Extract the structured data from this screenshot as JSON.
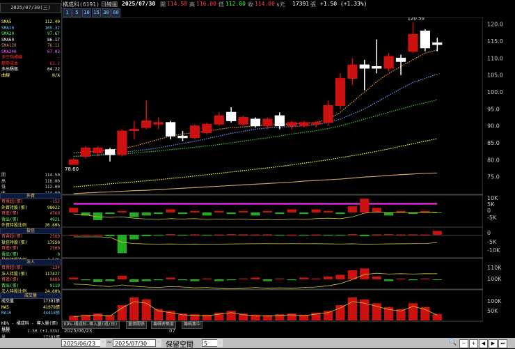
{
  "header": {
    "stock": "橘成科(6191)",
    "period": "日線圖",
    "date": "2025/07/30",
    "open_label": "開",
    "open": "114.50",
    "high_label": "高",
    "high": "116.00",
    "low_label": "低",
    "low": "112.00",
    "close_label": "收",
    "close": "114.00",
    "s_mark": "s元",
    "volume": "17391",
    "vol_unit": "張",
    "change": "+1.50 (+1.33%)"
  },
  "period_buttons": [
    "1",
    "5",
    "10",
    "15",
    "30",
    "60"
  ],
  "left": {
    "date": "2025/07/30(三)",
    "ma": [
      {
        "k": "SMA5",
        "v": "112.40",
        "c": "#ffff66"
      },
      {
        "k": "SMA10",
        "v": "105.32",
        "c": "#66ccff"
      },
      {
        "k": "SMA20",
        "v": "97.67",
        "c": "#66ff66"
      },
      {
        "k": "SMA60",
        "v": "86.17",
        "c": "#ffffff"
      },
      {
        "k": "SMA120",
        "v": "76.11",
        "c": "#cc9966"
      },
      {
        "k": "SMA240",
        "v": "67.03",
        "c": "#ff66ff"
      },
      {
        "k": "多空指標線",
        "v": "—",
        "c": "#ff3333"
      },
      {
        "k": "趨勢成本",
        "v": "63.2",
        "c": "#ff3333"
      },
      {
        "k": "多出積極",
        "v": "64.22",
        "c": "#ffffff"
      },
      {
        "k": "曲線",
        "v": "N/A",
        "c": "#ffff66"
      }
    ],
    "ohlc": [
      {
        "k": "開",
        "v": "114.50"
      },
      {
        "k": "高",
        "v": "116.00"
      },
      {
        "k": "低",
        "v": "112.00"
      },
      {
        "k": "收",
        "v": "114.00"
      }
    ],
    "foreign_head": "外資",
    "foreign": [
      {
        "k": "買賣超(張)",
        "v": "-152",
        "c": "#ff6666"
      },
      {
        "k": "外資持股(張)",
        "v": "98022",
        "c": "#ffff66"
      },
      {
        "k": "買進(張)",
        "v": "4769",
        "c": "#ff6666"
      },
      {
        "k": "賣出(張)",
        "v": "4921",
        "c": "#66ff66"
      },
      {
        "k": "外資持股比例",
        "v": "20.60%",
        "c": "#ffff66"
      }
    ],
    "dealer_head": "投信",
    "dealer": [
      {
        "k": "買賣超(張)",
        "v": "2569",
        "c": "#ff6666"
      },
      {
        "k": "投信持股(張)",
        "v": "17550",
        "c": "#ffff66"
      },
      {
        "k": "買進(張)",
        "v": "2569",
        "c": "#ff6666"
      },
      {
        "k": "賣出(張)",
        "v": "0",
        "c": "#66ff66"
      },
      {
        "k": "投信持股比例",
        "v": "3.52%",
        "c": "#ffff66"
      }
    ],
    "inst_head": "法人",
    "inst": [
      {
        "k": "買賣超(張)",
        "v": "-234",
        "c": "#ff6666"
      },
      {
        "k": "法人持股(張)",
        "v": "117427",
        "c": "#ffff66"
      },
      {
        "k": "買進(張)",
        "v": "8886",
        "c": "#ff6666"
      },
      {
        "k": "賣出(張)",
        "v": "9119",
        "c": "#66ff66"
      },
      {
        "k": "法人持股比例",
        "v": "24.60%",
        "c": "#ffff66"
      }
    ],
    "vol_head": "成交量",
    "vol": [
      {
        "k": "成交量",
        "v": "17391張",
        "c": "#ffffff"
      },
      {
        "k": "MA5",
        "v": "41078張",
        "c": "#ffff66"
      },
      {
        "k": "MA10",
        "v": "44418張",
        "c": "#66ccff"
      }
    ],
    "kd_label": "KD% - 橘成科 - 導入量(張) 日線",
    "bottom_rows": [
      {
        "k": "漲跌",
        "v": "1.50 (+1.33%)"
      },
      {
        "k": "量",
        "v": "17391張"
      }
    ]
  },
  "tabs": [
    "KD%-橘成科-導入量(週/日)",
    "量價關係",
    "籌碼密集度",
    "籌碼集中"
  ],
  "bottom": {
    "start_date": "2025/06/23",
    "sep": "~",
    "end_date": "2025/07/30",
    "reserve_label": "保留空間",
    "reserve_value": "5",
    "date_axis": [
      "2025/06/23",
      "07"
    ]
  },
  "axis": {
    "price_ticks": [
      "120.0",
      "115.0",
      "110.0",
      "105.0",
      "100.0",
      "95.0",
      "90.0",
      "85.0",
      "80.0",
      "75.0"
    ],
    "foreign_ticks": [
      "10K",
      "5K",
      "0",
      "-5K"
    ],
    "dealer_ticks": [
      "0",
      "-5K",
      "-10K"
    ],
    "inst_ticks": [
      "110K",
      "100K"
    ],
    "vol_ticks": [
      "100K",
      "50K"
    ]
  },
  "annotations": {
    "high": "120.50",
    "low": "78.60"
  },
  "colors": {
    "up": "#cc1111",
    "down": "#ffffff",
    "ma5": "#ff9933",
    "ma10": "#6699ff",
    "ma20": "#33cc33",
    "ma60": "#ffff33",
    "ma120": "#cc9966",
    "ma240": "#ff33ff",
    "panel_border": "#444444"
  },
  "chart_data": {
    "type": "candlestick",
    "candles": [
      {
        "o": 78.6,
        "h": 80.5,
        "l": 78.6,
        "c": 80.0
      },
      {
        "o": 81.0,
        "h": 84.0,
        "l": 80.5,
        "c": 83.5
      },
      {
        "o": 82.0,
        "h": 84.0,
        "l": 81.0,
        "c": 83.5
      },
      {
        "o": 83.0,
        "h": 83.5,
        "l": 79.5,
        "c": 81.5
      },
      {
        "o": 81.5,
        "h": 89.0,
        "l": 81.0,
        "c": 88.5
      },
      {
        "o": 89.0,
        "h": 91.5,
        "l": 86.0,
        "c": 89.0
      },
      {
        "o": 89.5,
        "h": 97.5,
        "l": 89.0,
        "c": 91.5
      },
      {
        "o": 90.5,
        "h": 92.5,
        "l": 89.0,
        "c": 91.0
      },
      {
        "o": 91.0,
        "h": 91.5,
        "l": 86.0,
        "c": 87.0
      },
      {
        "o": 87.0,
        "h": 88.5,
        "l": 85.5,
        "c": 86.5
      },
      {
        "o": 86.5,
        "h": 90.5,
        "l": 86.0,
        "c": 90.0
      },
      {
        "o": 88.0,
        "h": 91.0,
        "l": 87.5,
        "c": 90.5
      },
      {
        "o": 90.5,
        "h": 94.0,
        "l": 90.0,
        "c": 93.0
      },
      {
        "o": 94.0,
        "h": 95.5,
        "l": 91.0,
        "c": 91.5
      },
      {
        "o": 90.5,
        "h": 93.0,
        "l": 90.0,
        "c": 92.5
      },
      {
        "o": 92.0,
        "h": 92.5,
        "l": 89.5,
        "c": 90.0
      },
      {
        "o": 90.0,
        "h": 92.5,
        "l": 89.0,
        "c": 92.0
      },
      {
        "o": 93.0,
        "h": 94.0,
        "l": 89.0,
        "c": 90.0
      },
      {
        "o": 90.0,
        "h": 91.5,
        "l": 89.0,
        "c": 91.0
      },
      {
        "o": 90.0,
        "h": 91.5,
        "l": 89.5,
        "c": 91.0
      },
      {
        "o": 90.5,
        "h": 91.5,
        "l": 89.5,
        "c": 91.0
      },
      {
        "o": 91.0,
        "h": 97.5,
        "l": 90.0,
        "c": 96.0
      },
      {
        "o": 96.0,
        "h": 105.5,
        "l": 95.0,
        "c": 104.0
      },
      {
        "o": 104.0,
        "h": 110.0,
        "l": 102.0,
        "c": 108.0
      },
      {
        "o": 108.0,
        "h": 109.5,
        "l": 100.5,
        "c": 107.0
      },
      {
        "o": 107.5,
        "h": 115.5,
        "l": 105.5,
        "c": 107.0
      },
      {
        "o": 107.0,
        "h": 111.5,
        "l": 106.0,
        "c": 110.5
      },
      {
        "o": 110.0,
        "h": 111.0,
        "l": 105.0,
        "c": 109.0
      },
      {
        "o": 112.0,
        "h": 120.5,
        "l": 111.5,
        "c": 117.0
      },
      {
        "o": 118.0,
        "h": 118.5,
        "l": 112.0,
        "c": 113.0
      },
      {
        "o": 114.5,
        "h": 116.0,
        "l": 112.0,
        "c": 114.0
      }
    ],
    "ma_lines": {
      "ma5": [
        82,
        82.3,
        82.6,
        82.9,
        83.3,
        84,
        85,
        86,
        87,
        87.6,
        88,
        88.4,
        89,
        89.5,
        89.7,
        90,
        90.3,
        90.4,
        90.6,
        90.8,
        91,
        92,
        94,
        97,
        100,
        103,
        105.5,
        107.5,
        109.5,
        111.5,
        112.4
      ],
      "ma10": [
        81,
        81.2,
        81.5,
        81.8,
        82.2,
        82.6,
        83,
        83.5,
        84.2,
        84.8,
        85.5,
        86.2,
        87,
        87.8,
        88.4,
        89,
        89.4,
        89.6,
        89.8,
        90,
        90.3,
        91,
        92,
        93.5,
        95,
        97,
        99,
        101,
        102.8,
        104,
        105.3
      ],
      "ma20": [
        81,
        81.2,
        81.3,
        81.5,
        81.7,
        82,
        82.3,
        82.6,
        83,
        83.3,
        83.7,
        84.1,
        84.5,
        85,
        85.5,
        86,
        86.5,
        87,
        87.6,
        88.1,
        88.6,
        89.2,
        90,
        91,
        92,
        93,
        94,
        95,
        96,
        96.8,
        97.7
      ],
      "ma60": [
        72,
        72.3,
        72.6,
        72.9,
        73.2,
        73.5,
        73.8,
        74.1,
        74.5,
        74.8,
        75.2,
        75.6,
        76,
        76.4,
        76.8,
        77.2,
        77.6,
        78,
        78.5,
        79,
        79.5,
        80,
        80.6,
        81.2,
        81.8,
        82.5,
        83.2,
        84,
        84.7,
        85.5,
        86.2
      ],
      "ma120": [
        70,
        70.2,
        70.4,
        70.5,
        70.7,
        70.9,
        71,
        71.2,
        71.4,
        71.6,
        71.8,
        72,
        72.2,
        72.4,
        72.6,
        72.8,
        73,
        73.2,
        73.4,
        73.7,
        73.9,
        74.1,
        74.3,
        74.6,
        74.9,
        75.1,
        75.4,
        75.6,
        75.8,
        76,
        76.1
      ],
      "ma240": [
        67,
        67,
        67,
        67,
        67,
        67,
        67,
        67,
        67,
        67,
        67,
        67,
        67,
        67,
        67,
        67,
        67,
        67,
        67,
        67,
        67,
        67,
        67,
        67,
        67,
        67,
        67,
        67,
        67,
        67,
        67.03
      ]
    },
    "foreign_net": [
      3,
      -2,
      -5,
      -1,
      1,
      -3,
      -2,
      -1,
      2,
      -1,
      1,
      -2,
      1,
      -1,
      1,
      -2,
      1,
      -1,
      2,
      -1,
      2,
      1,
      -1,
      4,
      9,
      3,
      -2,
      1,
      -1,
      1,
      -0.2
    ],
    "dealer_net": [
      0,
      0,
      0,
      -1,
      -12,
      -3,
      -1,
      -0.5,
      0.5,
      -0.5,
      0.3,
      -0.5,
      0.2,
      0.5,
      0.3,
      0.2,
      0.3,
      -0.2,
      0.1,
      -0.2,
      0.2,
      -0.5,
      -0.3,
      0.5,
      -1,
      0.3,
      0.5,
      0.2,
      0.3,
      0.2,
      2.5
    ],
    "inst_net": [
      2,
      -1,
      -3,
      -2,
      4,
      -3,
      -2,
      -1,
      2,
      -1,
      -2,
      1,
      -2,
      -1,
      1,
      2,
      -2,
      1,
      -1,
      2,
      1,
      3,
      5,
      10,
      12,
      3,
      -2,
      1,
      -1,
      1,
      -0.2
    ],
    "volume": [
      12,
      15,
      18,
      14,
      40,
      60,
      55,
      30,
      25,
      18,
      16,
      15,
      20,
      25,
      18,
      15,
      14,
      16,
      18,
      15,
      20,
      25,
      40,
      60,
      55,
      45,
      35,
      30,
      45,
      35,
      17
    ],
    "xlabel": "",
    "ylabel": ""
  }
}
